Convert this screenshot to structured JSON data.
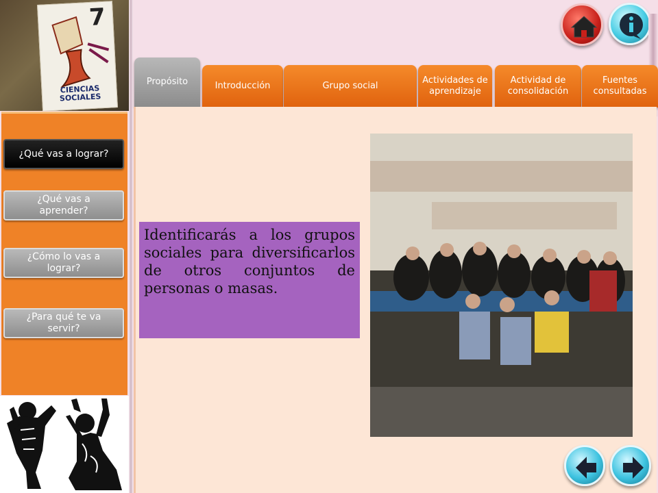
{
  "book": {
    "number": "7",
    "title": "CIENCIAS SOCIALES"
  },
  "header_buttons": {
    "home_icon": "home-icon",
    "info_icon": "info-icon"
  },
  "tabs": [
    {
      "label": "Propósito",
      "active": true
    },
    {
      "label": "Introducción",
      "active": false
    },
    {
      "label": "Grupo social",
      "active": false
    },
    {
      "label": "Actividades de aprendizaje",
      "active": false
    },
    {
      "label": "Actividad de consolidación",
      "active": false
    },
    {
      "label": "Fuentes consultadas",
      "active": false
    }
  ],
  "sidebar": {
    "items": [
      {
        "label": "¿Qué vas a lograr?",
        "active": true
      },
      {
        "label": "¿Qué vas a aprender?",
        "active": false
      },
      {
        "label": "¿Cómo lo vas a lograr?",
        "active": false
      },
      {
        "label": "¿Para qué te va servir?",
        "active": false
      }
    ]
  },
  "main": {
    "purpose_text": "Identificarás a los grupos sociales para diversificarlos de otros conjuntos de personas o masas."
  },
  "nav": {
    "prev_icon": "arrow-left-icon",
    "next_icon": "arrow-right-icon"
  },
  "colors": {
    "accent": "#ef8227",
    "purple_box": "#a563bf",
    "content_bg": "#fde6d6"
  }
}
